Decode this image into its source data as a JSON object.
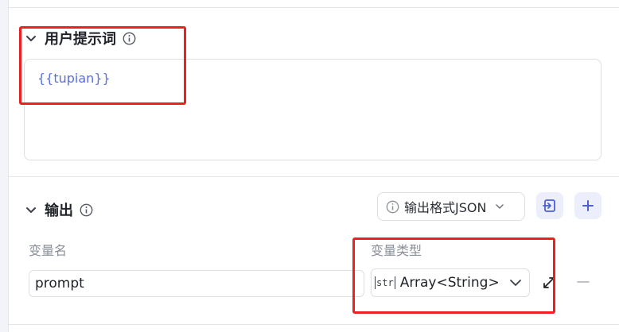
{
  "prompt_section": {
    "title": "用户提示词",
    "template_text": "{{tupian}}"
  },
  "output_section": {
    "title": "输出",
    "format_button_label": "输出格式JSON",
    "columns": {
      "name_label": "变量名",
      "type_label": "变量类型"
    },
    "row": {
      "name_value": "prompt",
      "type_badge": "str",
      "type_value": "Array<String>"
    }
  },
  "colors": {
    "accent": "#5a6fe0",
    "highlight_box": "#f01e1e",
    "button_bg": "#eceefb"
  },
  "icons": [
    "chevron-down-icon",
    "info-icon",
    "import-icon",
    "plus-icon",
    "expand-icon",
    "minus-icon"
  ]
}
